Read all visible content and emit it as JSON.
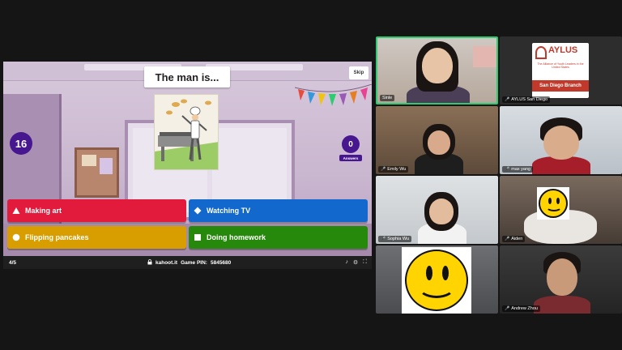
{
  "kahoot": {
    "question": "The man is...",
    "skip_label": "Skip",
    "timer": "16",
    "answers_count": "0",
    "answers_label": "Answers",
    "answers": [
      {
        "label": "Making art",
        "shape": "triangle",
        "color": "#e21b3c"
      },
      {
        "label": "Watching TV",
        "shape": "diamond",
        "color": "#1368ce"
      },
      {
        "label": "Flipping pancakes",
        "shape": "circle",
        "color": "#d89e00"
      },
      {
        "label": "Doing homework",
        "shape": "square",
        "color": "#26890c"
      }
    ],
    "bottom_bar": {
      "progress": "4/5",
      "site": "kahoot.it",
      "pin_label": "Game PIN:",
      "pin": "5845680"
    }
  },
  "participants": [
    {
      "name": "Sinle",
      "muted": false,
      "active": true
    },
    {
      "name": "AYLUS San Diego",
      "muted": true
    },
    {
      "name": "Emily Wu",
      "muted": true
    },
    {
      "name": "max yang",
      "muted": true
    },
    {
      "name": "Sophia Wu",
      "muted": true
    },
    {
      "name": "Aiden",
      "muted": true
    },
    {
      "name": "Andrew Zhou",
      "muted": true
    }
  ],
  "aylus_logo": {
    "word": "AYLUS",
    "tagline": "The Alliance of Youth Leaders in the United States",
    "branch": "San Diego Branch"
  },
  "colors": {
    "kahoot_purple": "#46178f",
    "active_speaker": "#2ecc71"
  }
}
